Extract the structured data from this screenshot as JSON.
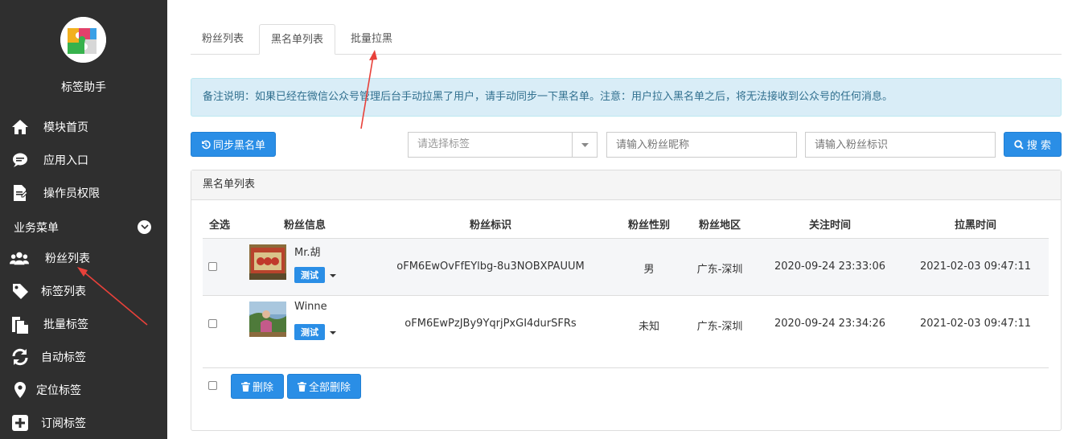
{
  "sidebar": {
    "app_name": "标签助手",
    "items_top": [
      {
        "label": "模块首页",
        "icon": "home-icon"
      },
      {
        "label": "应用入口",
        "icon": "chat-icon"
      },
      {
        "label": "操作员权限",
        "icon": "document-edit-icon"
      }
    ],
    "section_label": "业务菜单",
    "items_business": [
      {
        "label": "粉丝列表",
        "icon": "users-icon"
      },
      {
        "label": "标签列表",
        "icon": "tag-icon"
      },
      {
        "label": "批量标签",
        "icon": "copy-icon"
      },
      {
        "label": "自动标签",
        "icon": "refresh-icon"
      },
      {
        "label": "定位标签",
        "icon": "map-marker-icon"
      },
      {
        "label": "订阅标签",
        "icon": "plus-square-icon"
      }
    ]
  },
  "tabs": [
    {
      "label": "粉丝列表"
    },
    {
      "label": "黑名单列表"
    },
    {
      "label": "批量拉黑"
    }
  ],
  "notice": "备注说明：如果已经在微信公众号管理后台手动拉黑了用户，请手动同步一下黑名单。注意：用户拉入黑名单之后，将无法接收到公众号的任何消息。",
  "toolbar": {
    "sync_label": "同步黑名单",
    "tag_select_placeholder": "请选择标签",
    "nickname_placeholder": "请输入粉丝昵称",
    "openid_placeholder": "请输入粉丝标识",
    "search_label": "搜 索"
  },
  "panel": {
    "title": "黑名单列表",
    "columns": [
      "全选",
      "粉丝信息",
      "粉丝标识",
      "粉丝性别",
      "粉丝地区",
      "关注时间",
      "拉黑时间"
    ],
    "rows": [
      {
        "name": "Mr.胡",
        "tag": "测试",
        "openid": "oFM6EwOvFfEYlbg-8u3NOBXPAUUM",
        "gender": "男",
        "region": "广东-深圳",
        "follow_time": "2020-09-24 23:33:06",
        "block_time": "2021-02-03 09:47:11"
      },
      {
        "name": "Winne",
        "tag": "测试",
        "openid": "oFM6EwPzJBy9YqrjPxGI4durSFRs",
        "gender": "未知",
        "region": "广东-深圳",
        "follow_time": "2020-09-24 23:34:26",
        "block_time": "2021-02-03 09:47:11"
      }
    ],
    "delete_label": "删除",
    "delete_all_label": "全部删除"
  },
  "colors": {
    "sidebar_bg": "#2f2f2f",
    "primary": "#2a8ee6",
    "notice_bg": "#d9edf7",
    "annotation_arrow": "#e8413a"
  }
}
